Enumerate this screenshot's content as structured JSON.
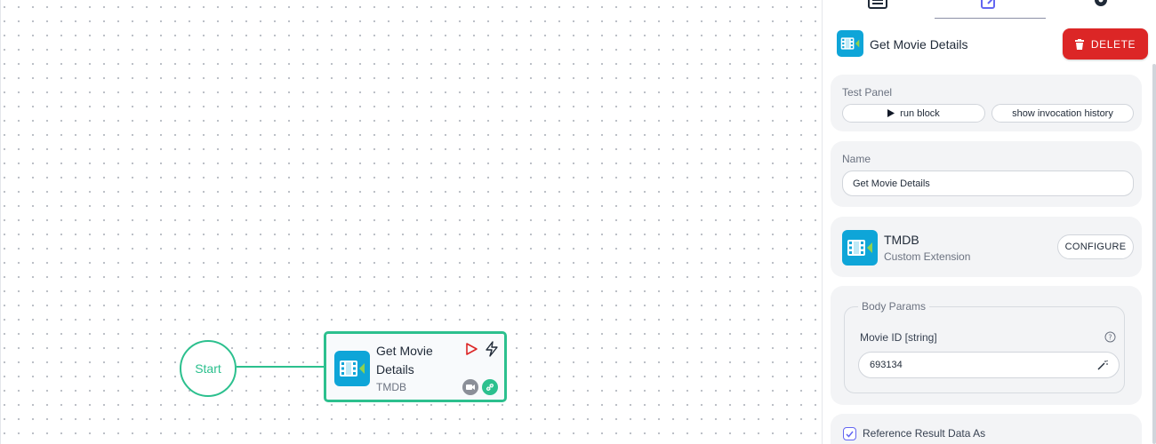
{
  "canvas": {
    "start_node": {
      "label": "Start"
    },
    "block_node": {
      "title": "Get Movie Details",
      "subtitle": "TMDB"
    }
  },
  "panel": {
    "tabs": [
      {
        "icon": "list-icon"
      },
      {
        "icon": "edit-icon",
        "active": true
      },
      {
        "icon": "gear-icon"
      }
    ],
    "header": {
      "title": "Get Movie Details",
      "delete_label": "DELETE"
    },
    "test_panel": {
      "label": "Test Panel",
      "run_label": "run block",
      "history_label": "show invocation history"
    },
    "name_field": {
      "label": "Name",
      "value": "Get Movie Details"
    },
    "extension": {
      "name": "TMDB",
      "type": "Custom Extension",
      "configure_label": "CONFIGURE"
    },
    "body_params": {
      "legend": "Body Params",
      "param_label": "Movie ID [string]",
      "param_value": "693134"
    },
    "reference": {
      "label": "Reference Result Data As",
      "checked": true
    }
  },
  "colors": {
    "accent_green": "#2cc08e",
    "delete_red": "#dc2626",
    "icon_blue": "#0ea5d8",
    "active_tab": "#6366f1"
  }
}
